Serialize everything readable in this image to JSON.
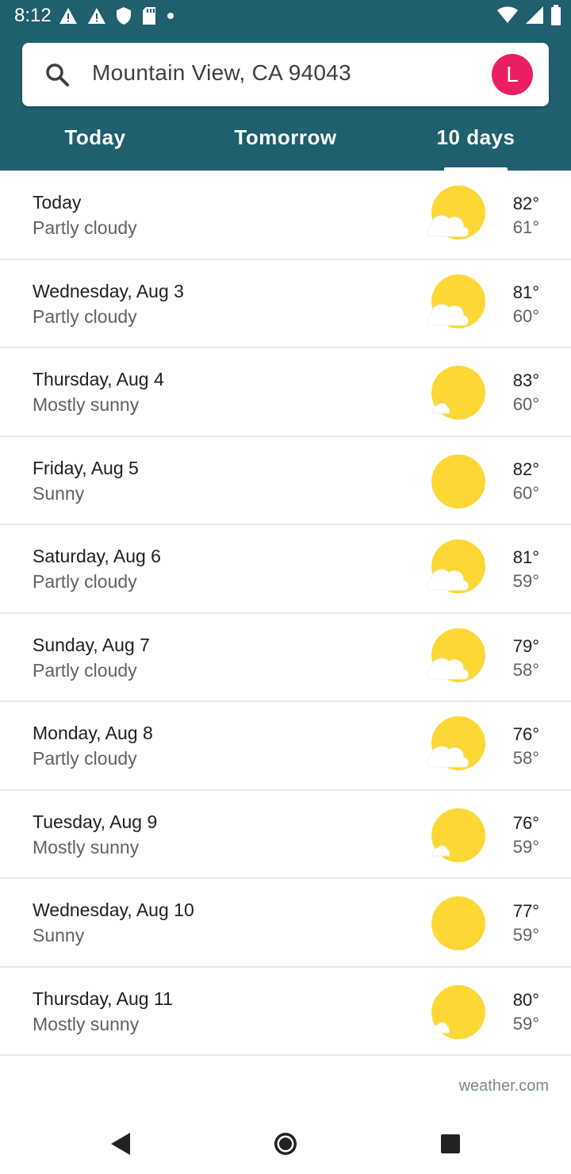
{
  "status_bar": {
    "time": "8:12"
  },
  "search": {
    "location": "Mountain View, CA 94043"
  },
  "account": {
    "initial": "L",
    "color": "#e91e63"
  },
  "tabs": [
    {
      "label": "Today",
      "selected": false
    },
    {
      "label": "Tomorrow",
      "selected": false
    },
    {
      "label": "10 days",
      "selected": true
    }
  ],
  "forecast": [
    {
      "day": "Today",
      "condition": "Partly cloudy",
      "high": "82°",
      "low": "61°",
      "icon": "partly-cloudy-icon"
    },
    {
      "day": "Wednesday, Aug 3",
      "condition": "Partly cloudy",
      "high": "81°",
      "low": "60°",
      "icon": "partly-cloudy-icon"
    },
    {
      "day": "Thursday, Aug 4",
      "condition": "Mostly sunny",
      "high": "83°",
      "low": "60°",
      "icon": "mostly-sunny-icon"
    },
    {
      "day": "Friday, Aug 5",
      "condition": "Sunny",
      "high": "82°",
      "low": "60°",
      "icon": "sunny-icon"
    },
    {
      "day": "Saturday, Aug 6",
      "condition": "Partly cloudy",
      "high": "81°",
      "low": "59°",
      "icon": "partly-cloudy-icon"
    },
    {
      "day": "Sunday, Aug 7",
      "condition": "Partly cloudy",
      "high": "79°",
      "low": "58°",
      "icon": "partly-cloudy-icon"
    },
    {
      "day": "Monday, Aug 8",
      "condition": "Partly cloudy",
      "high": "76°",
      "low": "58°",
      "icon": "partly-cloudy-icon"
    },
    {
      "day": "Tuesday, Aug 9",
      "condition": "Mostly sunny",
      "high": "76°",
      "low": "59°",
      "icon": "mostly-sunny-icon"
    },
    {
      "day": "Wednesday, Aug 10",
      "condition": "Sunny",
      "high": "77°",
      "low": "59°",
      "icon": "sunny-icon"
    },
    {
      "day": "Thursday, Aug 11",
      "condition": "Mostly sunny",
      "high": "80°",
      "low": "59°",
      "icon": "mostly-sunny-icon"
    }
  ],
  "attribution": "weather.com",
  "colors": {
    "header": "#1f5f6e",
    "sun": "#fdd835",
    "cloud": "#ffffff"
  }
}
